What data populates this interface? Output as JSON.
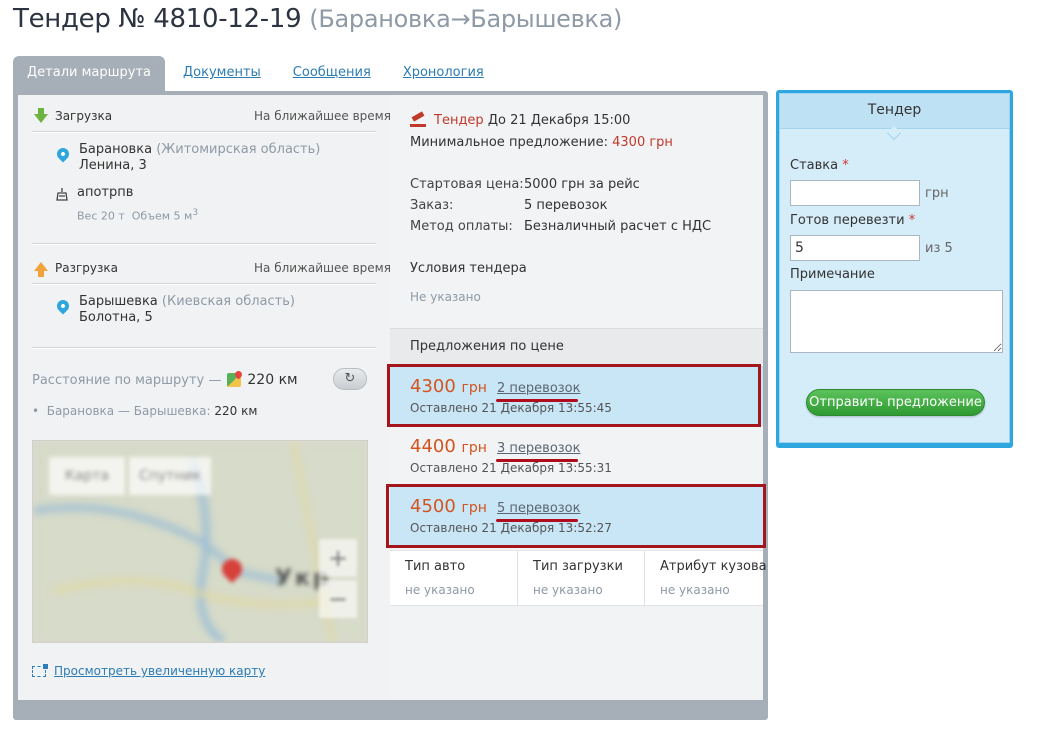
{
  "header": {
    "title": "Тендер № 4810-12-19",
    "route": "(Барановка→Барышевка)"
  },
  "tabs": [
    {
      "label": "Детали маршрута",
      "active": true
    },
    {
      "label": "Документы"
    },
    {
      "label": "Сообщения"
    },
    {
      "label": "Хронология"
    }
  ],
  "loading": {
    "heading": "Загрузка",
    "when": "На ближайшее время",
    "city": "Барановка",
    "region": "(Житомирская область)",
    "street": "Ленина, 3",
    "cargo_name": "апотрпв",
    "cargo_weight": "Вес 20 т",
    "cargo_volume": "Объем 5 м",
    "cargo_volume_unit_sup": "3"
  },
  "unloading": {
    "heading": "Разгрузка",
    "when": "На ближайшее время",
    "city": "Барышевка",
    "region": "(Киевская область)",
    "street": "Болотна, 5"
  },
  "distance": {
    "label": "Расстояние по маршруту —",
    "value": "220 км",
    "segment_label": "Барановка — Барышевка:",
    "segment_value": "220 км",
    "refresh_icon": "↻"
  },
  "map": {
    "tab_map": "Карта",
    "tab_satellite": "Спутник",
    "zoom_in": "+",
    "zoom_out": "−",
    "map_text": "Укр",
    "link": "Просмотреть увеличенную карту"
  },
  "tender": {
    "word": "Тендер",
    "deadline": "До 21 Декабря 15:00",
    "min_offer_label": "Минимальное предложение:",
    "min_offer_value": "4300 грн",
    "start_price_label": "Стартовая цена:",
    "start_price_value": "5000 грн за рейс",
    "order_label": "Заказ:",
    "order_value": "5 перевозок",
    "payment_label": "Метод оплаты:",
    "payment_value": "Безналичный расчет с НДС",
    "conditions_label": "Условия тендера",
    "conditions_value": "Не указано"
  },
  "offers": {
    "heading": "Предложения по цене",
    "items": [
      {
        "price": "4300",
        "currency": "грн",
        "qty": "2 перевозок",
        "left": "Оставлено 21 Декабря 13:55:45",
        "highlighted": true
      },
      {
        "price": "4400",
        "currency": "грн",
        "qty": "3 перевозок",
        "left": "Оставлено 21 Декабря 13:55:31",
        "highlighted": false
      },
      {
        "price": "4500",
        "currency": "грн",
        "qty": "5 перевозок",
        "left": "Оставлено 21 Декабря 13:52:27",
        "highlighted": true
      }
    ]
  },
  "properties": [
    {
      "header": "Тип авто",
      "value": "не указано"
    },
    {
      "header": "Тип загрузки",
      "value": "не указано"
    },
    {
      "header": "Атрибут кузова",
      "value": "не указано"
    }
  ],
  "bid": {
    "title": "Тендер",
    "rate_label": "Ставка",
    "required_mark": "*",
    "rate_value": "",
    "rate_unit": "грн",
    "ready_label": "Готов перевезти",
    "ready_value": "5",
    "ready_unit": "из 5",
    "note_label": "Примечание",
    "note_value": "",
    "submit_label": "Отправить предложение"
  },
  "colors": {
    "accent_blue": "#2ea7e0",
    "price_orange": "#d4541f",
    "tender_red": "#c0392b",
    "submit_green": "#2f9a32",
    "highlight_frame": "#a5161c"
  }
}
